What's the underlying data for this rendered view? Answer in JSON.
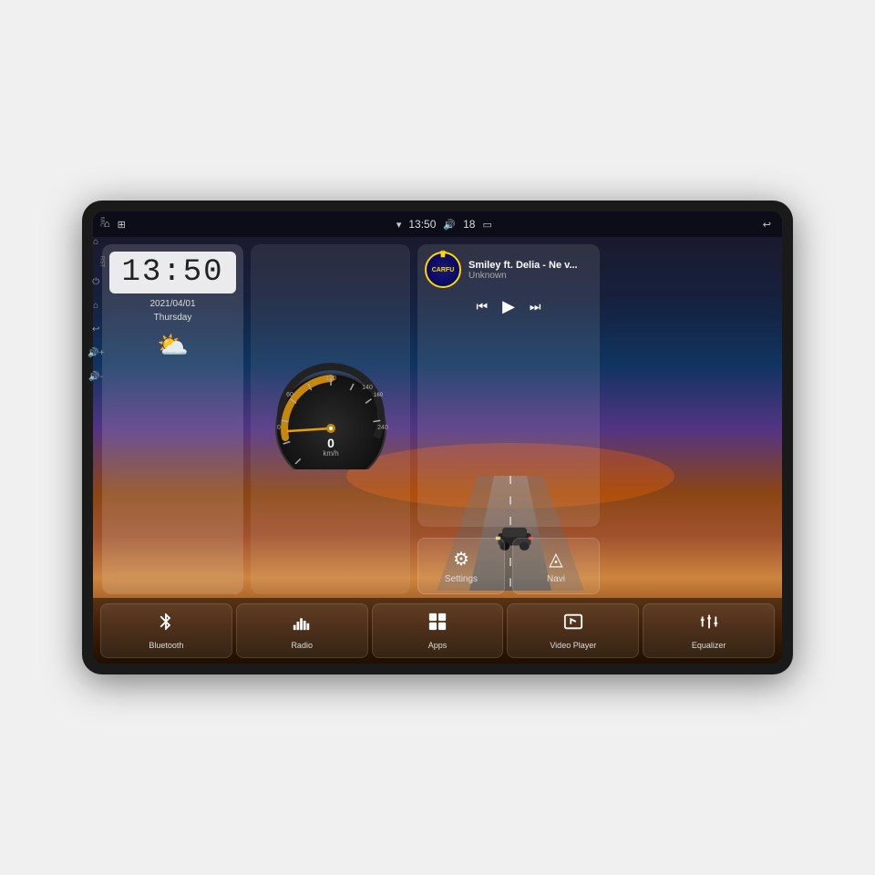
{
  "device": {
    "title": "Car Android Head Unit"
  },
  "status_bar": {
    "left_icons": [
      "⌂",
      "⌂"
    ],
    "time": "13:50",
    "volume": "18",
    "wifi_icon": "▼",
    "battery_icon": "▭",
    "back_icon": "↩"
  },
  "side_labels": {
    "mic": "MIC",
    "rst": "RST"
  },
  "clock": {
    "time": "13:50",
    "date": "2021/04/01",
    "day": "Thursday"
  },
  "weather": {
    "icon": "⛅"
  },
  "music": {
    "title": "Smiley ft. Delia - Ne v...",
    "artist": "Unknown",
    "logo_text": "CARFU"
  },
  "quick_buttons": [
    {
      "id": "settings",
      "icon": "⚙",
      "label": "Settings"
    },
    {
      "id": "navi",
      "icon": "▲",
      "label": "Navi"
    }
  ],
  "bottom_buttons": [
    {
      "id": "bluetooth",
      "label": "Bluetooth"
    },
    {
      "id": "radio",
      "label": "Radio"
    },
    {
      "id": "apps",
      "label": "Apps"
    },
    {
      "id": "video-player",
      "label": "Video Player"
    },
    {
      "id": "equalizer",
      "label": "Equalizer"
    }
  ],
  "speedometer": {
    "speed": "0",
    "unit": "km/h",
    "max": 240
  }
}
